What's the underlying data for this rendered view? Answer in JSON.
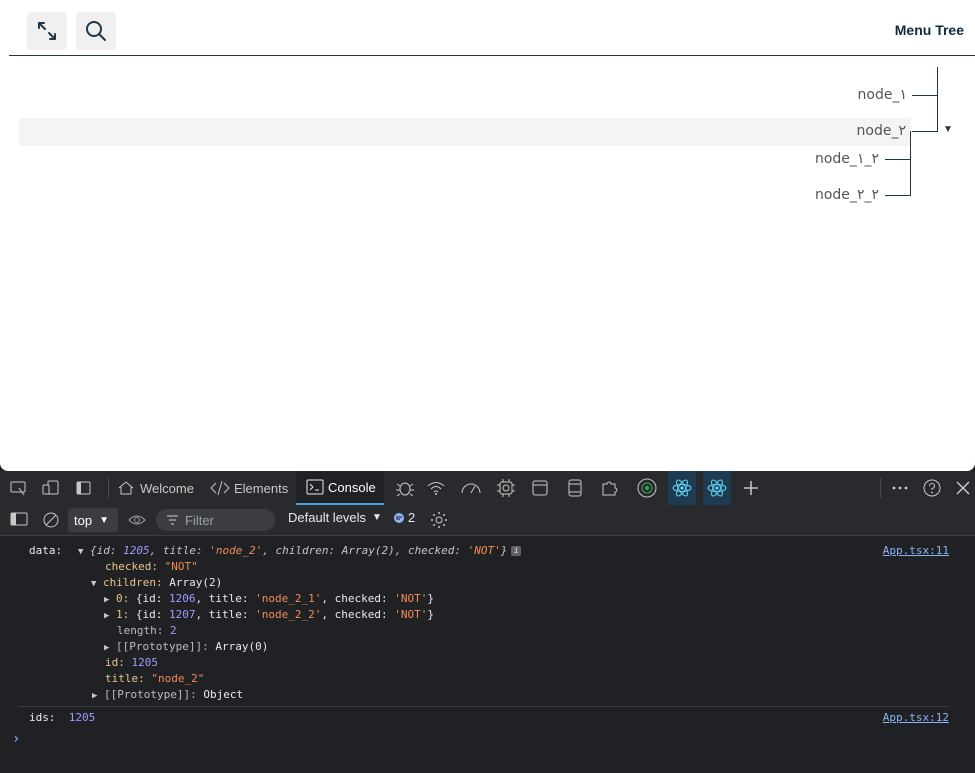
{
  "app": {
    "title": "Menu Tree",
    "tree": [
      {
        "label": "node_١"
      },
      {
        "label": "node_٢"
      },
      {
        "label": "node_٢_١"
      },
      {
        "label": "node_٢_٢"
      }
    ]
  },
  "devtools": {
    "tabs": {
      "welcome": "Welcome",
      "elements": "Elements",
      "console": "Console"
    },
    "toolbar": {
      "context": "top",
      "filter_placeholder": "Filter",
      "levels": "Default levels",
      "message_count": "2"
    },
    "console": {
      "log1_label": "data:",
      "log1_summary_prefix": "{id: ",
      "log1_summary_id": "1205",
      "log1_summary_mid1": ", title: ",
      "log1_summary_title": "'node_2'",
      "log1_summary_mid2": ", children: Array(2), checked: ",
      "log1_summary_checked": "'NOT'",
      "log1_summary_end": "}",
      "checked_key": "checked: ",
      "checked_val": "\"NOT\"",
      "children_key": "children: ",
      "children_val": "Array(2)",
      "child0_key": "0: ",
      "child0_a": "{id: ",
      "child0_id": "1206",
      "child0_b": ", title: ",
      "child0_title": "'node_2_1'",
      "child0_c": ", checked: ",
      "child0_checked": "'NOT'",
      "child0_d": "}",
      "child1_key": "1: ",
      "child1_a": "{id: ",
      "child1_id": "1207",
      "child1_b": ", title: ",
      "child1_title": "'node_2_2'",
      "child1_c": ", checked: ",
      "child1_checked": "'NOT'",
      "child1_d": "}",
      "length_key": "length: ",
      "length_val": "2",
      "proto_arr_key": "[[Prototype]]: ",
      "proto_arr_val": "Array(0)",
      "id_key": "id: ",
      "id_val": "1205",
      "title_key": "title: ",
      "title_val": "\"node_2\"",
      "proto_obj_key": "[[Prototype]]: ",
      "proto_obj_val": "Object",
      "log1_source": "App.tsx:11",
      "log2_label": "ids: ",
      "log2_val": "1205",
      "log2_source": "App.tsx:12",
      "prompt": "›"
    }
  },
  "colors": {
    "accent": "#4f9dde",
    "tree_line": "#1e3a4a",
    "number": "#9c9cff",
    "string": "#f28b54"
  }
}
